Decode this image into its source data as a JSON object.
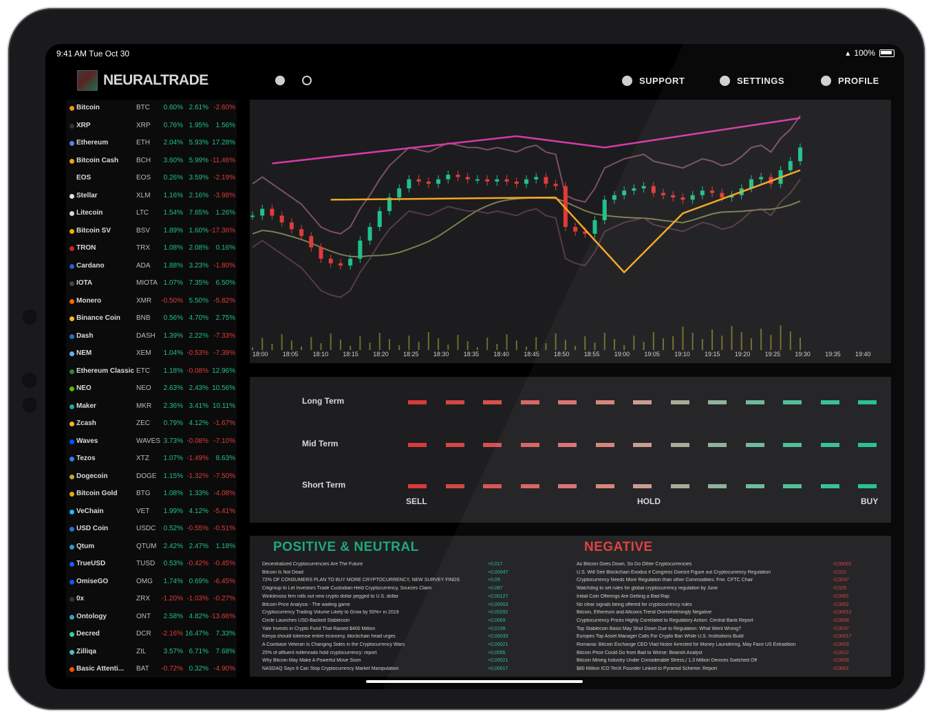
{
  "status": {
    "time": "9:41 AM  Tue Oct 30",
    "battery": "100%"
  },
  "header": {
    "brand": "NEURALTRADE",
    "icons": [
      "rocket-icon",
      "gauge-icon"
    ],
    "nav": [
      {
        "label": "SUPPORT",
        "icon": "support-icon"
      },
      {
        "label": "SETTINGS",
        "icon": "gear-icon"
      },
      {
        "label": "PROFILE",
        "icon": "user-icon"
      }
    ]
  },
  "ticker": [
    {
      "name": "Bitcoin",
      "symbol": "BTC",
      "c1": "0.60%",
      "c2": "2.61%",
      "c3": "-2.60%",
      "color": "#f7931a"
    },
    {
      "name": "XRP",
      "symbol": "XRP",
      "c1": "0.76%",
      "c2": "1.95%",
      "c3": "1.56%",
      "color": "#333333"
    },
    {
      "name": "Ethereum",
      "symbol": "ETH",
      "c1": "2.04%",
      "c2": "5.93%",
      "c3": "17.28%",
      "color": "#627eea"
    },
    {
      "name": "Bitcoin Cash",
      "symbol": "BCH",
      "c1": "3.60%",
      "c2": "5.99%",
      "c3": "-11.46%",
      "color": "#f0a21d"
    },
    {
      "name": "EOS",
      "symbol": "EOS",
      "c1": "0.26%",
      "c2": "3.59%",
      "c3": "-2.19%",
      "color": "#0b0b0b"
    },
    {
      "name": "Stellar",
      "symbol": "XLM",
      "c1": "1.16%",
      "c2": "2.16%",
      "c3": "-3.98%",
      "color": "#e0e0e0"
    },
    {
      "name": "Litecoin",
      "symbol": "LTC",
      "c1": "1.54%",
      "c2": "7.65%",
      "c3": "1.26%",
      "color": "#d8d8d8"
    },
    {
      "name": "Bitcoin SV",
      "symbol": "BSV",
      "c1": "1.89%",
      "c2": "1.60%",
      "c3": "-17.36%",
      "color": "#eab300"
    },
    {
      "name": "TRON",
      "symbol": "TRX",
      "c1": "1.08%",
      "c2": "2.08%",
      "c3": "0.16%",
      "color": "#c62828"
    },
    {
      "name": "Cardano",
      "symbol": "ADA",
      "c1": "1.88%",
      "c2": "3.23%",
      "c3": "-1.80%",
      "color": "#2a5ada"
    },
    {
      "name": "IOTA",
      "symbol": "MIOTA",
      "c1": "1.07%",
      "c2": "7.35%",
      "c3": "6.50%",
      "color": "#444444"
    },
    {
      "name": "Monero",
      "symbol": "XMR",
      "c1": "-0.50%",
      "c2": "5.50%",
      "c3": "-5.82%",
      "color": "#ff6600"
    },
    {
      "name": "Binance Coin",
      "symbol": "BNB",
      "c1": "0.56%",
      "c2": "4.70%",
      "c3": "2.75%",
      "color": "#f3ba2f"
    },
    {
      "name": "Dash",
      "symbol": "DASH",
      "c1": "1.39%",
      "c2": "2.22%",
      "c3": "-7.33%",
      "color": "#1c75bc"
    },
    {
      "name": "NEM",
      "symbol": "XEM",
      "c1": "1.04%",
      "c2": "-0.53%",
      "c3": "-7.39%",
      "color": "#67b2e8"
    },
    {
      "name": "Ethereum Classic",
      "symbol": "ETC",
      "c1": "1.18%",
      "c2": "-0.08%",
      "c3": "12.96%",
      "color": "#328332"
    },
    {
      "name": "NEO",
      "symbol": "NEO",
      "c1": "2.63%",
      "c2": "2.43%",
      "c3": "10.56%",
      "color": "#58bf00"
    },
    {
      "name": "Maker",
      "symbol": "MKR",
      "c1": "2.36%",
      "c2": "3.41%",
      "c3": "10.11%",
      "color": "#1aab9b"
    },
    {
      "name": "Zcash",
      "symbol": "ZEC",
      "c1": "0.79%",
      "c2": "4.12%",
      "c3": "-1.67%",
      "color": "#f4b728"
    },
    {
      "name": "Waves",
      "symbol": "WAVES",
      "c1": "3.73%",
      "c2": "-0.08%",
      "c3": "-7.10%",
      "color": "#0055ff"
    },
    {
      "name": "Tezos",
      "symbol": "XTZ",
      "c1": "1.07%",
      "c2": "-1.49%",
      "c3": "8.63%",
      "color": "#2c7df7"
    },
    {
      "name": "Dogecoin",
      "symbol": "DOGE",
      "c1": "1.15%",
      "c2": "-1.32%",
      "c3": "-7.50%",
      "color": "#c2a633"
    },
    {
      "name": "Bitcoin Gold",
      "symbol": "BTG",
      "c1": "1.08%",
      "c2": "1.33%",
      "c3": "-4.08%",
      "color": "#eba809"
    },
    {
      "name": "VeChain",
      "symbol": "VET",
      "c1": "1.99%",
      "c2": "4.12%",
      "c3": "-5.41%",
      "color": "#15bdff"
    },
    {
      "name": "USD Coin",
      "symbol": "USDC",
      "c1": "0.52%",
      "c2": "-0.55%",
      "c3": "-0.51%",
      "color": "#2775ca"
    },
    {
      "name": "Qtum",
      "symbol": "QTUM",
      "c1": "2.42%",
      "c2": "2.47%",
      "c3": "1.18%",
      "color": "#2e9ad0"
    },
    {
      "name": "TrueUSD",
      "symbol": "TUSD",
      "c1": "0.53%",
      "c2": "-0.42%",
      "c3": "-0.45%",
      "color": "#1a5aff"
    },
    {
      "name": "OmiseGO",
      "symbol": "OMG",
      "c1": "1.74%",
      "c2": "0.69%",
      "c3": "-6.45%",
      "color": "#1a53f0"
    },
    {
      "name": "0x",
      "symbol": "ZRX",
      "c1": "-1.20%",
      "c2": "-1.03%",
      "c3": "-0.27%",
      "color": "#333333"
    },
    {
      "name": "Ontology",
      "symbol": "ONT",
      "c1": "2.58%",
      "c2": "4.82%",
      "c3": "-13.66%",
      "color": "#32a4be"
    },
    {
      "name": "Decred",
      "symbol": "DCR",
      "c1": "-2.16%",
      "c2": "16.47%",
      "c3": "7.33%",
      "color": "#2ed6a1"
    },
    {
      "name": "Zilliqa",
      "symbol": "ZIL",
      "c1": "3.57%",
      "c2": "6.71%",
      "c3": "7.68%",
      "color": "#49c1bf"
    },
    {
      "name": "Basic Attenti...",
      "symbol": "BAT",
      "c1": "-0.72%",
      "c2": "0.32%",
      "c3": "-4.90%",
      "color": "#ff5000"
    }
  ],
  "chart_data": {
    "type": "line",
    "x_ticks": [
      "18:00",
      "18:05",
      "18:10",
      "18:15",
      "18:20",
      "18:25",
      "18:30",
      "18:35",
      "18:40",
      "18:45",
      "18:50",
      "18:55",
      "19:00",
      "19:05",
      "19:10",
      "19:15",
      "19:20",
      "19:25",
      "19:30",
      "19:35",
      "19:40"
    ],
    "ylim": [
      0,
      100
    ],
    "price_close": [
      55,
      58,
      55,
      52,
      49,
      46,
      41,
      36,
      34,
      33,
      36,
      44,
      50,
      57,
      63,
      67,
      71,
      70,
      69,
      71,
      73,
      72,
      71,
      71,
      70,
      71,
      70,
      69,
      71,
      72,
      69,
      68,
      50,
      48,
      47,
      53,
      62,
      64,
      66,
      67,
      68,
      65,
      64,
      63,
      62,
      64,
      66,
      65,
      63,
      64,
      67,
      71,
      72,
      69,
      75,
      79,
      85
    ],
    "colors": {
      "up": "#21c08b",
      "down": "#e03b3b",
      "upper_band": "#d63aa8",
      "trend": "#f5a623",
      "bollinger": "#7d5067",
      "ma": "#7a7f50",
      "volume": "#6e6e2a"
    }
  },
  "signals": {
    "rows": [
      {
        "label": "Long Term",
        "levels": [
          0,
          1,
          2,
          3,
          4,
          5,
          6,
          7,
          8,
          9,
          10,
          11,
          12
        ]
      },
      {
        "label": "Mid Term",
        "levels": [
          0,
          1,
          2,
          3,
          4,
          5,
          6,
          7,
          8,
          9,
          10,
          11,
          12
        ]
      },
      {
        "label": "Short Term",
        "levels": [
          0,
          1,
          2,
          3,
          4,
          5,
          6,
          7,
          8,
          9,
          10,
          11,
          12
        ]
      }
    ],
    "axis": {
      "left": "SELL",
      "mid": "HOLD",
      "right": "BUY"
    }
  },
  "news": {
    "positive_title": "POSITIVE & NEUTRAL",
    "negative_title": "NEGATIVE",
    "positive": [
      {
        "t": "Decentralized Cryptocurrencies Are The Future",
        "v": "+0,017"
      },
      {
        "t": "Bitcoin Is Not Dead",
        "v": "+0,00047"
      },
      {
        "t": "72% OF CONSUMERS PLAN TO BUY MORE CRYPTOCURRENCY, NEW SURVEY FINDS",
        "v": "+0,09"
      },
      {
        "t": "Citigroup to Let Investors Trade Custodian-Held Cryptocurrency, Sources Claim",
        "v": "+0,087"
      },
      {
        "t": "Winklevoss firm rolls out new crypto dollar pegged to U.S. dollar",
        "v": "+0,00127"
      },
      {
        "t": "Bitcoin Price Analysis - The waiting game",
        "v": "+0,00003"
      },
      {
        "t": "Cryptocurrency Trading Volume Likely to Grow by 50%+ in 2019",
        "v": "+0,00292"
      },
      {
        "t": "Circle Launches USD-Backed Stablecoin",
        "v": "+0,0069"
      },
      {
        "t": "Yale Invests in Crypto Fund That Raised $400 Million",
        "v": "+0,0199"
      },
      {
        "t": "Kenya should tokenise entire economy, blockchain head urges",
        "v": "+0,00033"
      },
      {
        "t": "A Coinbase Veteran Is Changing Sides in the Cryptocurrency Wars",
        "v": "+0,00021"
      },
      {
        "t": "25% of affluent millennials hold cryptocurrency: report",
        "v": "+0,0065"
      },
      {
        "t": "Why Bitcoin May Make A Powerful Move Soon",
        "v": "+0,00021"
      },
      {
        "t": "NASDAQ Says It Can Stop Cryptocurrency Market Manipulation",
        "v": "+0,00017"
      }
    ],
    "negative": [
      {
        "t": "As Bitcoin Goes Down, So Do Other Cryptocurrencies",
        "v": "-0,00001"
      },
      {
        "t": "U.S. Will See Blockchain Exodus if Congress Doesnt Figure out Cryptocurrency Regulation",
        "v": "-0,012"
      },
      {
        "t": "Cryptocurrency Needs More Regulation than other Commodities: Fmr. CFTC Chair",
        "v": "-0,0037"
      },
      {
        "t": "Watchdog to set rules for global cryptocurrency regulation by June",
        "v": "-0,029"
      },
      {
        "t": "Initial Coin Offerings Are Getting a Bad Rap",
        "v": "-0,0091"
      },
      {
        "t": "No clear signals being offered for cryptocurrency rules",
        "v": "-0,0052"
      },
      {
        "t": "Bitcoin, Ethereum and Altcoins Trend Overwhelmingly Negative",
        "v": "-0,00012"
      },
      {
        "t": "Cryptocurrency Prices Highly Correlated to Regulatory Action: Central Bank Report",
        "v": "-0,0008"
      },
      {
        "t": "Top Stablecoin Basis May Shut Down Due to Regulation: What Went Wrong?",
        "v": "-0,0037"
      },
      {
        "t": "Europes Top Asset Manager Calls For Crypto Ban While U.S. Institutions Build",
        "v": "-0,00017"
      },
      {
        "t": "Romania: Bitcoin Exchange CEO Vlad Nistor Arrested for Money Laundering, May Face US Extradition",
        "v": "-0,0003"
      },
      {
        "t": "Bitcoin Price Could Go from Bad to Worse: Bearish Analyst",
        "v": "-0,0012"
      },
      {
        "t": "Bitcoin Mining Industry Under Considerable Stress,/ 1.3 Million Devices Switched Off",
        "v": "-0,0009"
      },
      {
        "t": "$80 Million ICO TenX Founder Linked to Pyramid Scheme: Report",
        "v": "-0,0001"
      }
    ]
  }
}
